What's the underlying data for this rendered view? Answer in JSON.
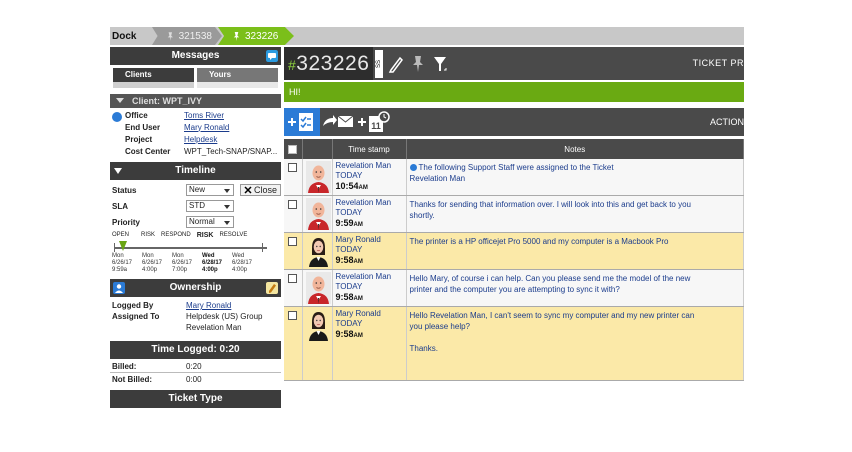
{
  "dock": {
    "label": "Dock",
    "tabs": [
      {
        "label": "321538",
        "active": false
      },
      {
        "label": "323226",
        "active": true
      }
    ]
  },
  "messages": {
    "title": "Messages",
    "tabs": [
      {
        "label": "Clients"
      },
      {
        "label": "Yours"
      }
    ]
  },
  "client": {
    "title": "Client: WPT_IVY",
    "fields": [
      {
        "key": "Office",
        "value": "Toms River",
        "link": true
      },
      {
        "key": "End User",
        "value": "Mary Ronald",
        "link": true
      },
      {
        "key": "Project",
        "value": "Helpdesk",
        "link": true
      },
      {
        "key": "Cost Center",
        "value": "WPT_Tech-SNAP/SNAP...",
        "link": false
      }
    ]
  },
  "timeline": {
    "title": "Timeline",
    "status_label": "Status",
    "status_value": "New",
    "close_label": "Close",
    "sla_label": "SLA",
    "sla_value": "STD",
    "priority_label": "Priority",
    "priority_value": "Normal",
    "stages": [
      "OPEN",
      "RISK",
      "RESPOND",
      "RISK",
      "RESOLVE"
    ],
    "dates": [
      {
        "day": "Mon",
        "date": "6/26/17",
        "time": "9:59a"
      },
      {
        "day": "Mon",
        "date": "6/26/17",
        "time": "4:00p"
      },
      {
        "day": "Mon",
        "date": "6/26/17",
        "time": "7:00p"
      },
      {
        "day": "Wed",
        "date": "6/28/17",
        "time": "4:00p"
      },
      {
        "day": "Wed",
        "date": "6/28/17",
        "time": "4:00p"
      }
    ]
  },
  "ownership": {
    "title": "Ownership",
    "logged_by_label": "Logged By",
    "logged_by": "Mary Ronald",
    "assigned_to_label": "Assigned To",
    "assigned_group": "Helpdesk (US) Group",
    "assigned_person": "Revelation Man"
  },
  "time_logged": {
    "title": "Time Logged: 0:20",
    "billed_label": "Billed:",
    "billed": "0:20",
    "not_billed_label": "Not Billed:",
    "not_billed": "0:00"
  },
  "ticket_type": {
    "title": "Ticket Type"
  },
  "ticket": {
    "hash": "#",
    "number": "323226",
    "ss": "SS",
    "header_right": "TICKET PR",
    "greeting": "HI!",
    "action_label": "ACTION"
  },
  "table": {
    "headers": {
      "time": "Time stamp",
      "notes": "Notes"
    },
    "rows": [
      {
        "name": "Revelation Man",
        "day": "TODAY",
        "time": "10:54",
        "ampm": "AM",
        "bg": "white",
        "avatar": "man",
        "note1": "The following Support Staff were assigned to the Ticket",
        "note2": "Revelation Man",
        "info": true
      },
      {
        "name": "Revelation Man",
        "day": "TODAY",
        "time": "9:59",
        "ampm": "AM",
        "bg": "white",
        "avatar": "man",
        "note1": "Thanks for sending that information over. I will look into this and get back to you",
        "note2": "shortly.",
        "info": false
      },
      {
        "name": "Mary Ronald",
        "day": "TODAY",
        "time": "9:58",
        "ampm": "AM",
        "bg": "yellow",
        "avatar": "woman",
        "note1": "The printer is a HP officejet Pro 5000  and my computer is a Macbook Pro",
        "note2": "",
        "info": false
      },
      {
        "name": "Revelation Man",
        "day": "TODAY",
        "time": "9:58",
        "ampm": "AM",
        "bg": "white",
        "avatar": "man",
        "note1": "Hello Mary, of course i can help. Can you please send me the model of the new",
        "note2": "printer and the computer you are attempting to sync it with?",
        "info": false
      },
      {
        "name": "Mary Ronald",
        "day": "TODAY",
        "time": "9:58",
        "ampm": "AM",
        "bg": "yellow",
        "avatar": "woman",
        "note1": "Hello Revelation Man, I can't seem to sync my computer and my new printer can",
        "note2": "you please help?",
        "note3": "Thanks.",
        "info": false
      }
    ]
  },
  "colors": {
    "accent_green": "#6aaa12",
    "dark": "#4a4a4a",
    "link": "#1b3c8c",
    "yellow_row": "#fbe9a8",
    "blue": "#2b7bd6"
  }
}
